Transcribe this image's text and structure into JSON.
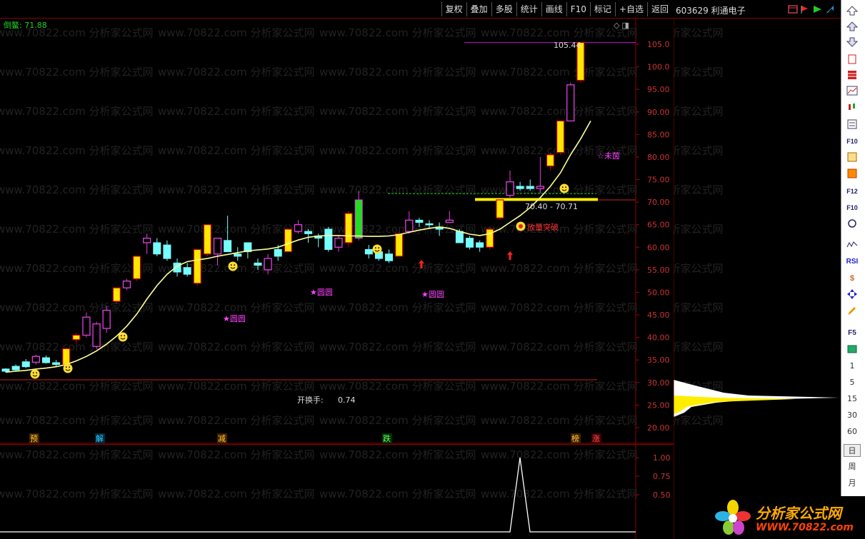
{
  "toolbar": {
    "buttons": [
      "复权",
      "叠加",
      "多股",
      "统计",
      "画线",
      "F10",
      "标记",
      "+自选",
      "返回"
    ]
  },
  "stock": {
    "title": "603629 利通电子"
  },
  "indicator": {
    "label": "倒鳌: 71.88"
  },
  "watermark": "www.70822.com 分析家公式网",
  "chart_data": {
    "type": "candlestick",
    "y_ticks": [
      "105.0",
      "100.0",
      "95.00",
      "90.00",
      "85.00",
      "80.00",
      "75.00",
      "70.00",
      "65.00",
      "60.00",
      "55.00",
      "50.00",
      "45.00",
      "40.00",
      "35.00",
      "30.00",
      "25.00",
      "20.00"
    ],
    "ylim": [
      18,
      108
    ],
    "annotations": {
      "high_label": "105.44",
      "range_label": "70.40 - 70.71",
      "breakout_label": "放量突破",
      "turnover_label": "开换手:",
      "turnover_value": "0.74",
      "star_labels": [
        "★圆圆",
        "★圆圆",
        "★圆圆",
        "☆未茵"
      ]
    },
    "event_labels": [
      "预",
      "解",
      "减",
      "跌",
      "榜",
      "涨"
    ],
    "candles": [
      {
        "o": 32.5,
        "h": 33.2,
        "l": 32.2,
        "c": 33.0,
        "s": "cyan"
      },
      {
        "o": 32.8,
        "h": 34.0,
        "l": 32.5,
        "c": 33.6,
        "s": "cyan"
      },
      {
        "o": 33.5,
        "h": 35.2,
        "l": 33.2,
        "c": 34.6,
        "s": "cyan"
      },
      {
        "o": 34.5,
        "h": 36.2,
        "l": 34.0,
        "c": 35.8,
        "s": "mag"
      },
      {
        "o": 35.5,
        "h": 36.0,
        "l": 34.2,
        "c": 34.4,
        "s": "cyan"
      },
      {
        "o": 34.4,
        "h": 35.0,
        "l": 33.4,
        "c": 34.0,
        "s": "cyan"
      },
      {
        "o": 34.0,
        "h": 37.8,
        "l": 33.8,
        "c": 37.5,
        "s": "gold"
      },
      {
        "o": 39.5,
        "h": 41.0,
        "l": 38.5,
        "c": 40.5,
        "s": "gold"
      },
      {
        "o": 40.5,
        "h": 45.5,
        "l": 40.0,
        "c": 44.5,
        "s": "mag"
      },
      {
        "o": 38.0,
        "h": 43.5,
        "l": 37.5,
        "c": 43.0,
        "s": "mag"
      },
      {
        "o": 42.0,
        "h": 47.0,
        "l": 41.0,
        "c": 46.0,
        "s": "mag"
      },
      {
        "o": 48.0,
        "h": 51.0,
        "l": 47.5,
        "c": 51.0,
        "s": "gold"
      },
      {
        "o": 51.0,
        "h": 53.0,
        "l": 50.5,
        "c": 52.5,
        "s": "mag"
      },
      {
        "o": 53.0,
        "h": 58.0,
        "l": 52.5,
        "c": 58.0,
        "s": "gold"
      },
      {
        "o": 61.0,
        "h": 63.0,
        "l": 58.5,
        "c": 62.0,
        "s": "mag"
      },
      {
        "o": 61.0,
        "h": 62.0,
        "l": 58.0,
        "c": 58.5,
        "s": "cyan"
      },
      {
        "o": 60.5,
        "h": 61.5,
        "l": 57.0,
        "c": 57.5,
        "s": "cyan"
      },
      {
        "o": 56.5,
        "h": 57.5,
        "l": 53.5,
        "c": 54.5,
        "s": "cyan"
      },
      {
        "o": 55.5,
        "h": 56.5,
        "l": 53.5,
        "c": 54.0,
        "s": "cyan"
      },
      {
        "o": 52.0,
        "h": 59.5,
        "l": 51.5,
        "c": 59.5,
        "s": "gold"
      },
      {
        "o": 58.5,
        "h": 65.0,
        "l": 58.0,
        "c": 65.0,
        "s": "gold"
      },
      {
        "o": 58.5,
        "h": 62.0,
        "l": 56.0,
        "c": 62.0,
        "s": "mag"
      },
      {
        "o": 61.5,
        "h": 67.0,
        "l": 60.0,
        "c": 59.0,
        "s": "cyan"
      },
      {
        "o": 58.0,
        "h": 60.0,
        "l": 57.0,
        "c": 58.5,
        "s": "cyan"
      },
      {
        "o": 59.0,
        "h": 61.0,
        "l": 57.5,
        "c": 61.0,
        "s": "cyan"
      },
      {
        "o": 56.5,
        "h": 57.5,
        "l": 55.0,
        "c": 56.0,
        "s": "cyan"
      },
      {
        "o": 55.0,
        "h": 58.5,
        "l": 54.0,
        "c": 57.5,
        "s": "mag"
      },
      {
        "o": 58.0,
        "h": 60.5,
        "l": 57.0,
        "c": 59.5,
        "s": "cyan"
      },
      {
        "o": 59.0,
        "h": 64.0,
        "l": 59.0,
        "c": 64.0,
        "s": "gold"
      },
      {
        "o": 63.5,
        "h": 66.0,
        "l": 63.0,
        "c": 65.0,
        "s": "mag"
      },
      {
        "o": 63.5,
        "h": 64.0,
        "l": 61.0,
        "c": 63.0,
        "s": "cyan"
      },
      {
        "o": 62.0,
        "h": 63.0,
        "l": 60.0,
        "c": 62.5,
        "s": "cyan"
      },
      {
        "o": 64.0,
        "h": 64.5,
        "l": 59.0,
        "c": 59.5,
        "s": "cyan"
      },
      {
        "o": 60.0,
        "h": 62.5,
        "l": 59.0,
        "c": 62.0,
        "s": "mag"
      },
      {
        "o": 61.0,
        "h": 68.0,
        "l": 60.0,
        "c": 67.5,
        "s": "gold"
      },
      {
        "o": 62.0,
        "h": 72.5,
        "l": 61.5,
        "c": 70.5,
        "s": "green"
      },
      {
        "o": 59.5,
        "h": 60.5,
        "l": 57.5,
        "c": 58.5,
        "s": "cyan"
      },
      {
        "o": 59.0,
        "h": 60.0,
        "l": 57.0,
        "c": 57.5,
        "s": "cyan"
      },
      {
        "o": 58.5,
        "h": 59.5,
        "l": 56.5,
        "c": 57.0,
        "s": "cyan"
      },
      {
        "o": 58.0,
        "h": 63.5,
        "l": 58.0,
        "c": 63.0,
        "s": "gold"
      },
      {
        "o": 63.5,
        "h": 68.0,
        "l": 63.0,
        "c": 66.0,
        "s": "mag"
      },
      {
        "o": 66.0,
        "h": 66.5,
        "l": 64.5,
        "c": 65.5,
        "s": "cyan"
      },
      {
        "o": 65.0,
        "h": 66.0,
        "l": 64.0,
        "c": 65.2,
        "s": "cyan"
      },
      {
        "o": 64.5,
        "h": 65.5,
        "l": 62.5,
        "c": 64.0,
        "s": "cyan"
      },
      {
        "o": 66.0,
        "h": 68.0,
        "l": 65.5,
        "c": 65.5,
        "s": "mag"
      },
      {
        "o": 63.5,
        "h": 64.0,
        "l": 61.0,
        "c": 61.0,
        "s": "cyan"
      },
      {
        "o": 62.0,
        "h": 62.5,
        "l": 59.5,
        "c": 60.0,
        "s": "cyan"
      },
      {
        "o": 61.0,
        "h": 61.5,
        "l": 59.0,
        "c": 60.0,
        "s": "cyan"
      },
      {
        "o": 60.0,
        "h": 64.5,
        "l": 59.5,
        "c": 64.0,
        "s": "gold"
      },
      {
        "o": 66.5,
        "h": 70.5,
        "l": 66.0,
        "c": 70.5,
        "s": "gold"
      },
      {
        "o": 71.5,
        "h": 77.0,
        "l": 71.0,
        "c": 74.5,
        "s": "mag"
      },
      {
        "o": 73.5,
        "h": 74.5,
        "l": 72.5,
        "c": 73.0,
        "s": "cyan"
      },
      {
        "o": 73.5,
        "h": 75.0,
        "l": 72.5,
        "c": 73.0,
        "s": "cyan"
      },
      {
        "o": 73.0,
        "h": 80.0,
        "l": 72.0,
        "c": 73.5,
        "s": "mag"
      },
      {
        "o": 78.0,
        "h": 81.0,
        "l": 77.0,
        "c": 80.5,
        "s": "gold"
      },
      {
        "o": 81.0,
        "h": 88.0,
        "l": 80.5,
        "c": 88.0,
        "s": "gold"
      },
      {
        "o": 88.0,
        "h": 96.5,
        "l": 88.0,
        "c": 96.0,
        "s": "mag"
      },
      {
        "o": 97.0,
        "h": 105.4,
        "l": 96.5,
        "c": 105.4,
        "s": "gold"
      }
    ],
    "ma": [
      32.3,
      32.5,
      32.7,
      33.0,
      33.2,
      33.5,
      34.0,
      34.8,
      35.8,
      37.0,
      38.5,
      40.3,
      42.5,
      45.2,
      48.5,
      51.5,
      54.0,
      55.8,
      56.8,
      57.2,
      57.5,
      58.0,
      58.4,
      58.8,
      59.2,
      59.4,
      59.6,
      60.0,
      60.8,
      61.6,
      62.2,
      62.5,
      62.6,
      62.6,
      62.5,
      62.5,
      62.4,
      62.4,
      62.5,
      62.8,
      63.3,
      63.8,
      64.2,
      64.5,
      64.2,
      63.5,
      62.9,
      62.6,
      63.0,
      64.0,
      65.5,
      67.0,
      68.8,
      71.0,
      73.5,
      76.5,
      80.5,
      84.0,
      88.0
    ],
    "sub_ticks": [
      "1.00",
      "0.75",
      "0.50"
    ],
    "sub_ylim": [
      0,
      1.1
    ],
    "volume_profile_periods": [
      "1",
      "5",
      "15",
      "30",
      "60"
    ]
  },
  "sidebar": {
    "periods": [
      "1",
      "5",
      "15",
      "30",
      "60"
    ],
    "tabs": [
      "日",
      "周",
      "月"
    ]
  },
  "logo": {
    "title": "分析家公式网",
    "url": "WWW.70822.com"
  }
}
